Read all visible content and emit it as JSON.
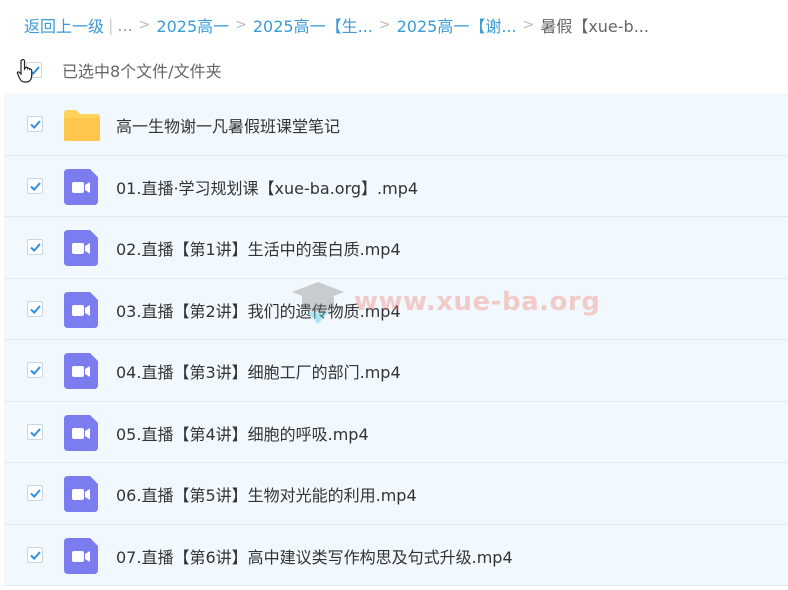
{
  "breadcrumb": {
    "back": "返回上一级",
    "ellipsis": "...",
    "items": [
      "2025高一",
      "2025高一【生...",
      "2025高一【谢..."
    ],
    "current": "暑假【xue-b..."
  },
  "selection": {
    "label": "已选中8个文件/文件夹"
  },
  "files": [
    {
      "type": "folder",
      "name": "高一生物谢一凡暑假班课堂笔记"
    },
    {
      "type": "video",
      "name": "01.直播·学习规划课【xue-ba.org】.mp4"
    },
    {
      "type": "video",
      "name": "02.直播【第1讲】生活中的蛋白质.mp4"
    },
    {
      "type": "video",
      "name": "03.直播【第2讲】我们的遗传物质.mp4"
    },
    {
      "type": "video",
      "name": "04.直播【第3讲】细胞工厂的部门.mp4"
    },
    {
      "type": "video",
      "name": "05.直播【第4讲】细胞的呼吸.mp4"
    },
    {
      "type": "video",
      "name": "06.直播【第5讲】生物对光能的利用.mp4"
    },
    {
      "type": "video",
      "name": "07.直播【第6讲】高中建议类写作构思及句式升级.mp4"
    }
  ],
  "watermark": {
    "text": "www.xue-ba.org"
  },
  "colors": {
    "link": "#3a9bd9",
    "folder": "#fdd35b",
    "video": "#7b7cf0",
    "check": "#2d8fe0",
    "row_bg": "#f1f8fe"
  }
}
